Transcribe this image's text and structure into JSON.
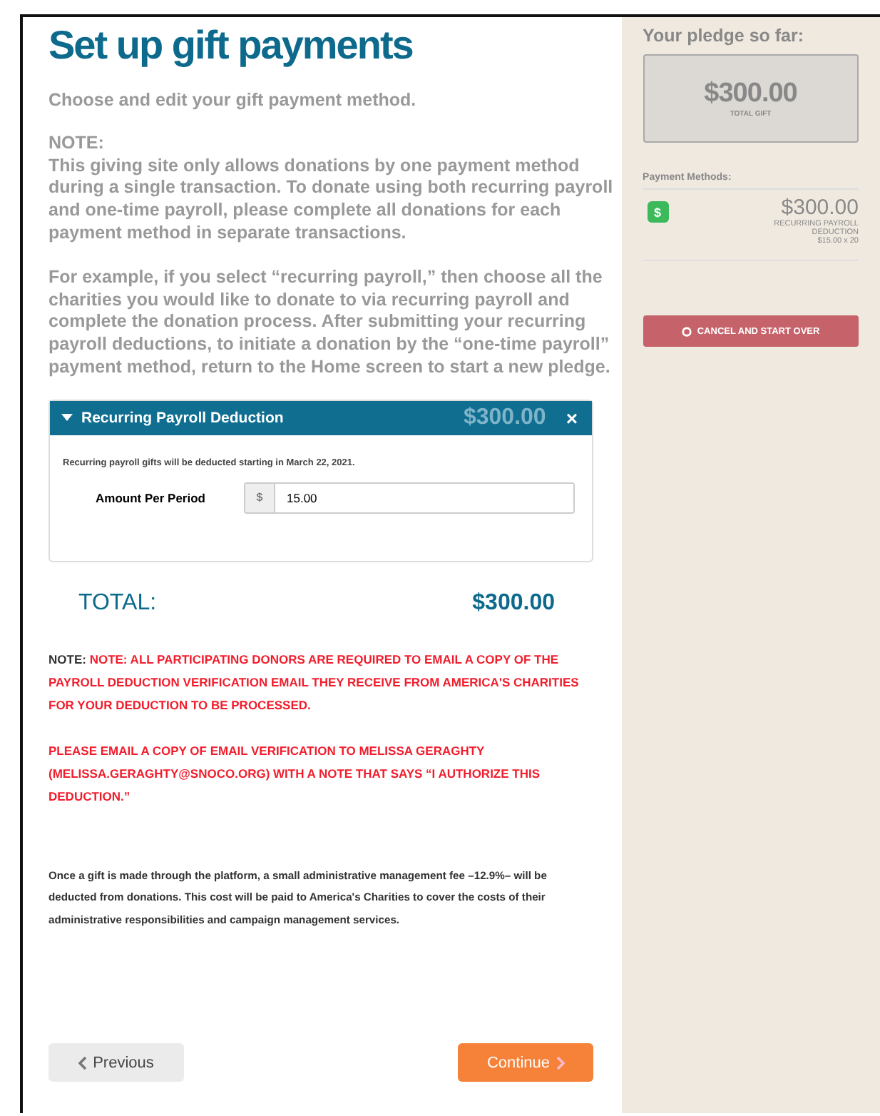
{
  "title": "Set up gift payments",
  "intro": "Choose and edit your gift payment method.",
  "note_heading": "NOTE:",
  "paragraphs": [
    "This giving site only allows donations by one payment method during a single transaction. To donate using both recurring payroll and one-time payroll, please complete all donations for each payment method in separate transactions.",
    "For example, if you select “recurring payroll,” then choose all the charities you would like to donate to via recurring payroll and complete the donation process. After submitting your recurring payroll deductions, to initiate a donation by the “one-time payroll” payment method, return to the Home screen to start a new pledge."
  ],
  "panel": {
    "title": "Recurring Payroll Deduction",
    "amount": "$300.00",
    "expanded": true,
    "close": "×",
    "notice": "Recurring payroll gifts will be deducted starting in March 22, 2021.",
    "field_label": "Amount Per Period",
    "currency": "$",
    "value": "15.00"
  },
  "total": {
    "label": "TOTAL:",
    "amount": "$300.00"
  },
  "alert": {
    "label": "NOTE:",
    "lines": [
      "NOTE: ALL PARTICIPATING DONORS ARE REQUIRED TO EMAIL A COPY OF THE PAYROLL DEDUCTION VERIFICATION EMAIL THEY RECEIVE FROM AMERICA'S CHARITIES FOR YOUR DEDUCTION TO BE PROCESSED.",
      "PLEASE EMAIL A COPY OF EMAIL VERIFICATION TO MELISSA GERAGHTY (MELISSA.GERAGHTY@SNOCO.ORG) WITH A NOTE THAT SAYS “I AUTHORIZE THIS DEDUCTION.”"
    ]
  },
  "fee_text": "Once a gift is made through the platform, a small administrative management fee –12.9%– will be deducted from donations. This cost will be paid to America's Charities to cover the costs of their administrative responsibilities and campaign management services.",
  "buttons": {
    "previous": "Previous",
    "continue": "Continue"
  },
  "sidebar": {
    "heading": "Your pledge so far:",
    "total": "$300.00",
    "total_label": "TOTAL GIFT",
    "methods_heading": "Payment Methods:",
    "methods": [
      {
        "icon": "$",
        "amount": "$300.00",
        "name": "RECURRING PAYROLL DEDUCTION",
        "detail": "$15.00 x 20"
      }
    ],
    "cancel": "CANCEL AND START OVER"
  }
}
